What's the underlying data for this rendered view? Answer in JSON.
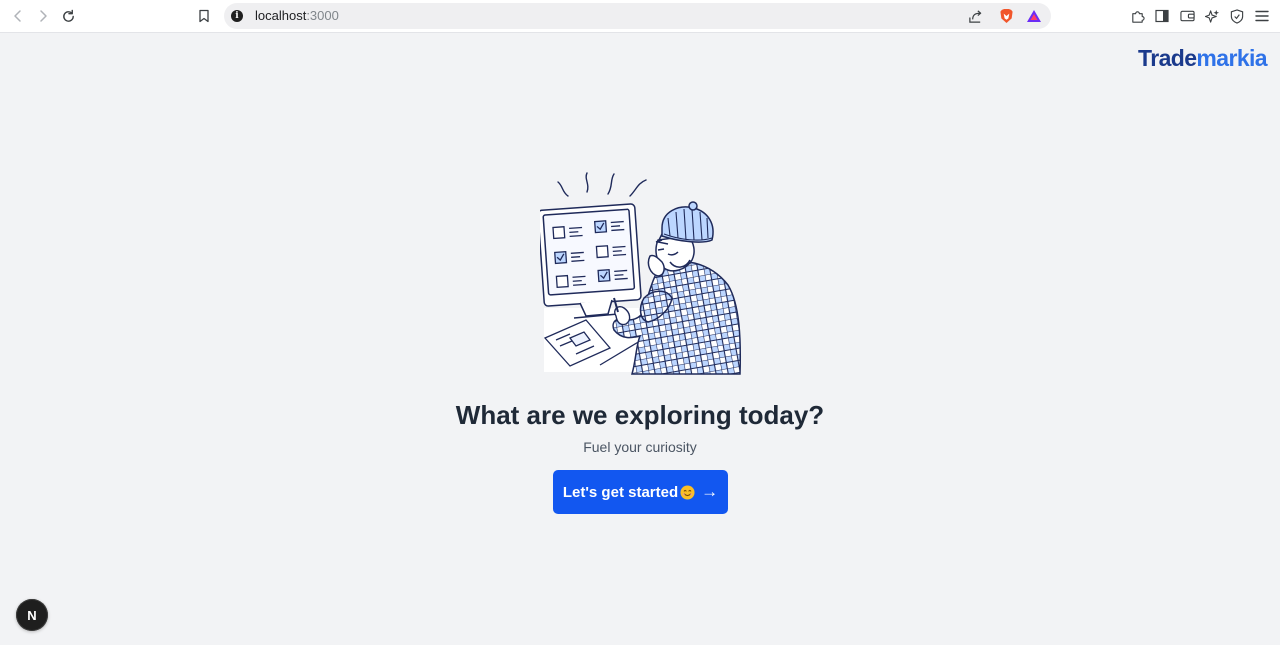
{
  "browser": {
    "url_host": "localhost",
    "url_port": ":3000",
    "info_glyph": "i"
  },
  "page": {
    "logo_part1": "Trade",
    "logo_part2": "markia",
    "headline": "What are we exploring today?",
    "subline": "Fuel your curiosity",
    "cta_label": "Let's get started",
    "cta_arrow": "→",
    "dev_badge": "N"
  },
  "colors": {
    "background": "#f2f3f5",
    "primary_button": "#1257f0",
    "logo_dark": "#1b3a8c",
    "logo_light": "#2f72e8",
    "headline": "#1f2937"
  },
  "icons": {
    "back": "chevron-left-icon",
    "forward": "chevron-right-icon",
    "reload": "reload-icon",
    "bookmark": "bookmark-icon",
    "share": "share-icon",
    "brave": "brave-shield-icon",
    "rewards": "brave-rewards-icon",
    "extensions": "puzzle-icon",
    "sidebar": "sidebar-icon",
    "wallet": "wallet-icon",
    "leo": "leo-ai-icon",
    "vpn": "vpn-shield-icon",
    "menu": "hamburger-menu-icon",
    "emoji": "smiling-face-icon"
  }
}
